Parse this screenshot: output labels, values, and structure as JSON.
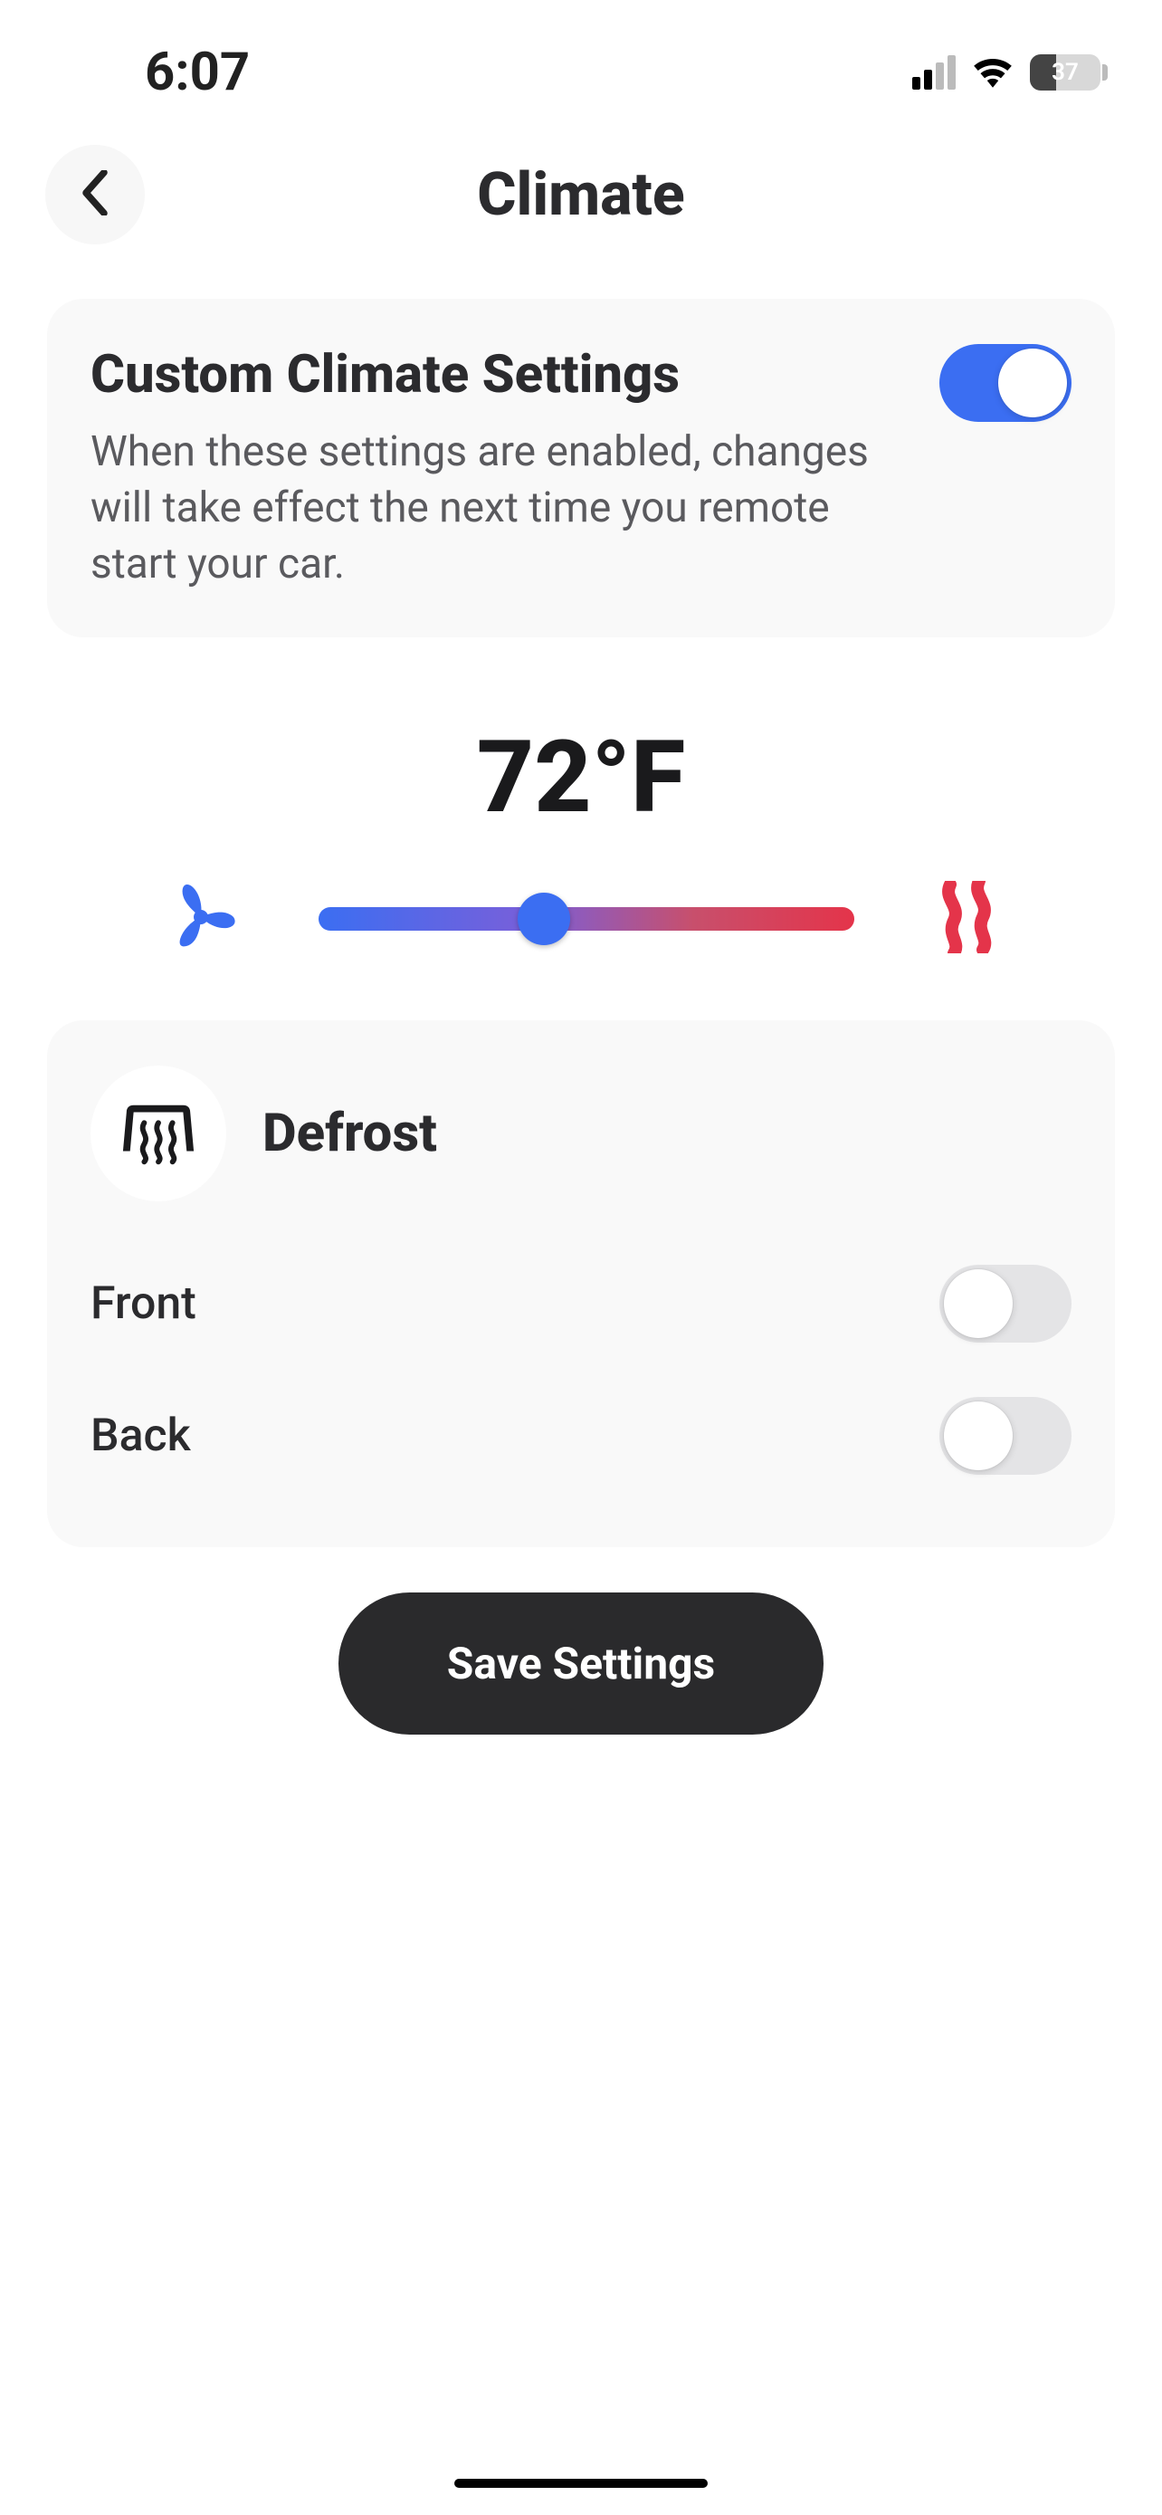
{
  "status": {
    "time": "6:07",
    "battery_percent": "37"
  },
  "header": {
    "title": "Climate"
  },
  "custom": {
    "title": "Custom Climate Settings",
    "description": "When these settings are enabled, changes will take effect the next time you remote start your car.",
    "enabled": true
  },
  "temperature": {
    "display": "72°F",
    "slider_position_percent": 42
  },
  "defrost": {
    "title": "Defrost",
    "front_label": "Front",
    "front_enabled": false,
    "back_label": "Back",
    "back_enabled": false
  },
  "save": {
    "label": "Save Settings"
  }
}
